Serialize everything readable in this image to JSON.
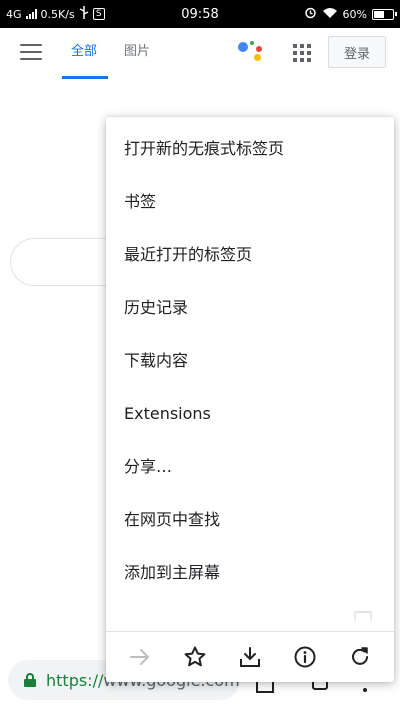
{
  "status_bar": {
    "network": "4G",
    "speed": "0.5K/s",
    "usb_icon": "usb-icon",
    "s_label": "S",
    "time": "09:58",
    "alarm_icon": "alarm-icon",
    "wifi_icon": "wifi-icon",
    "battery_percent": "60%",
    "battery_level": 0.6
  },
  "header": {
    "menu_icon": "hamburger-menu-icon",
    "tabs": [
      {
        "label": "全部",
        "active": true
      },
      {
        "label": "图片",
        "active": false
      }
    ],
    "assistant_icon": "google-assistant-icon",
    "apps_icon": "apps-grid-icon",
    "login_label": "登录"
  },
  "menu": {
    "items": [
      {
        "label": "打开新的无痕式标签页"
      },
      {
        "label": "书签"
      },
      {
        "label": "最近打开的标签页"
      },
      {
        "label": "历史记录"
      },
      {
        "label": "下载内容"
      },
      {
        "label": "Extensions"
      },
      {
        "label": "分享…"
      },
      {
        "label": "在网页中查找"
      },
      {
        "label": "添加到主屏幕"
      }
    ],
    "partial_item_label": "",
    "actions": [
      {
        "icon": "forward-arrow-icon",
        "enabled": false
      },
      {
        "icon": "star-icon",
        "enabled": true
      },
      {
        "icon": "download-icon",
        "enabled": true
      },
      {
        "icon": "info-icon",
        "enabled": true
      },
      {
        "icon": "refresh-icon",
        "enabled": true
      }
    ]
  },
  "url_bar": {
    "lock_icon": "lock-icon",
    "scheme": "https://",
    "host": "www.google.com"
  },
  "colors": {
    "accent": "#1a73e8",
    "secure": "#188038",
    "assistant_blue": "#4285f4",
    "assistant_red": "#ea4335",
    "assistant_yellow": "#fbbc05",
    "assistant_green": "#34a853"
  }
}
